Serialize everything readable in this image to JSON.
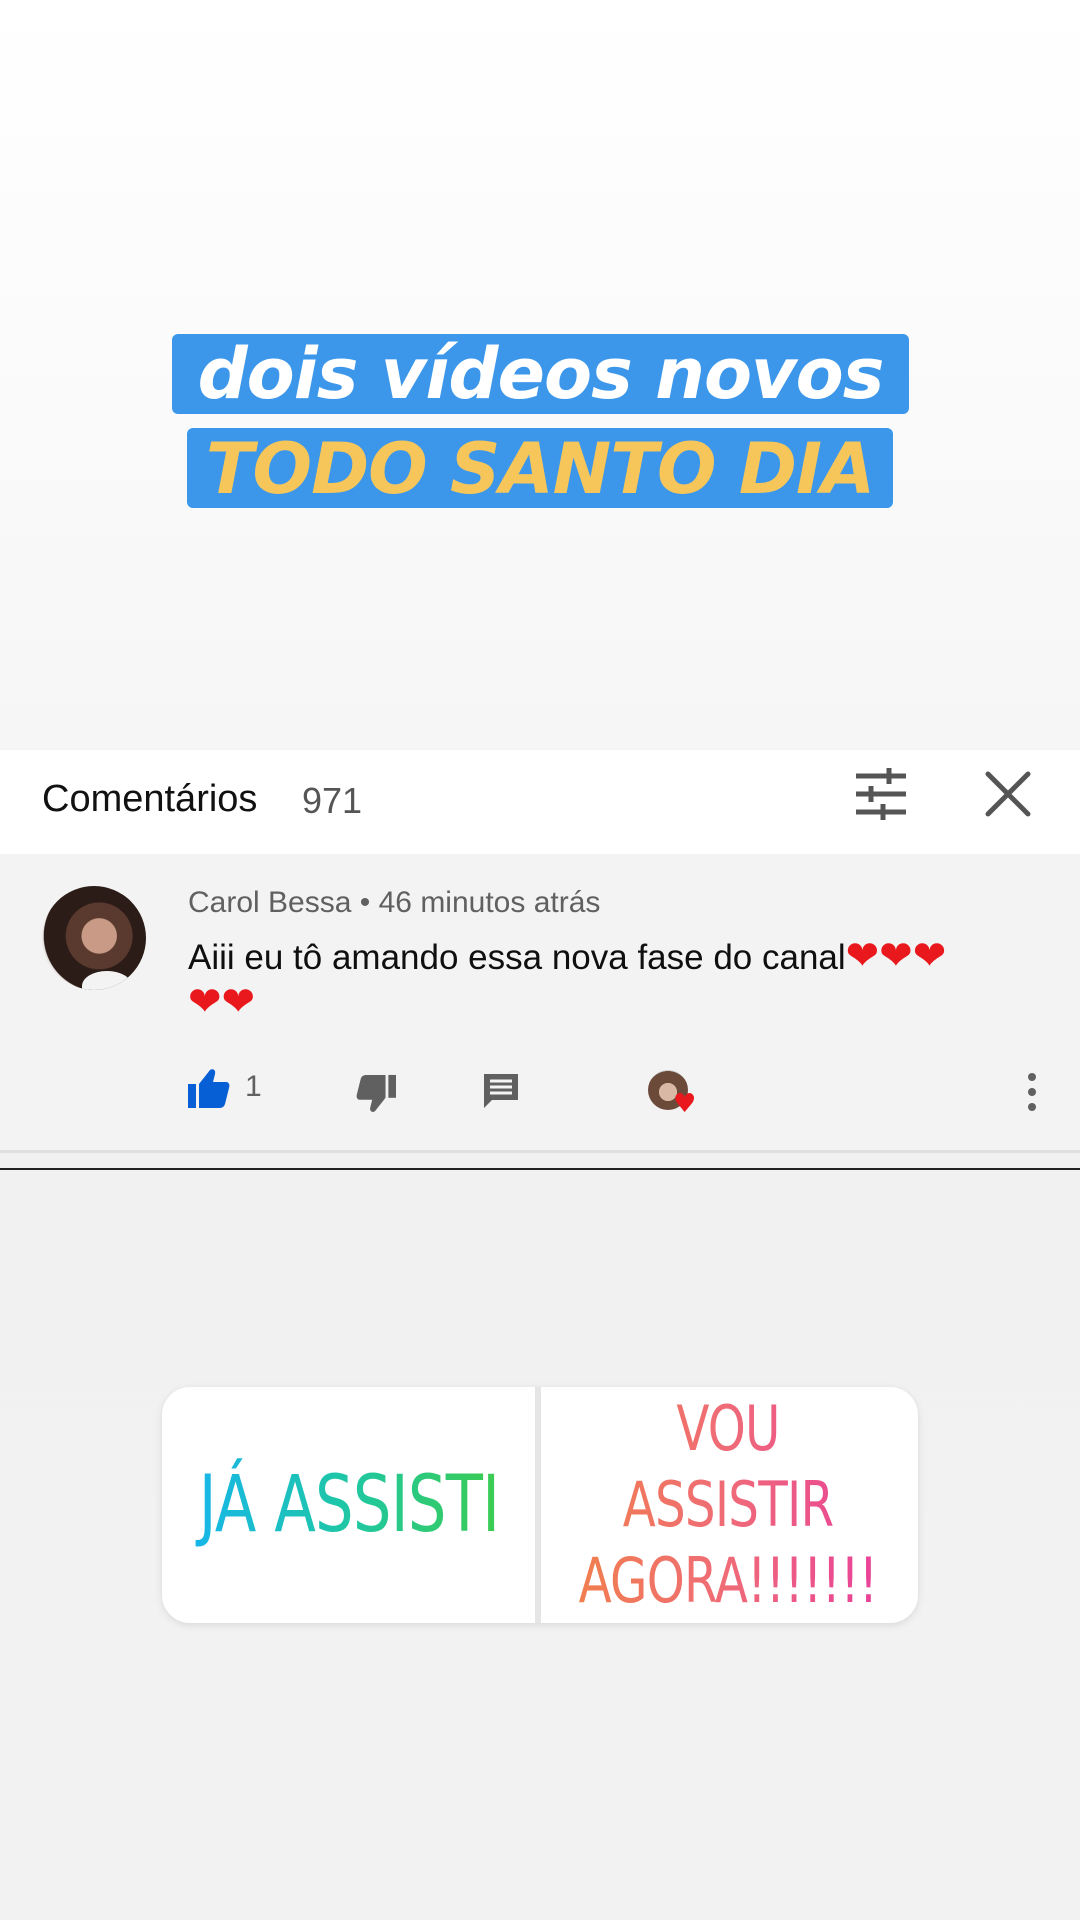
{
  "headline": {
    "line1": "dois vídeos novos",
    "line2": "TODO SANTO DIA"
  },
  "comments_header": {
    "title": "Comentários",
    "count": "971",
    "filter_icon": "sliders-icon",
    "close_icon": "close-icon"
  },
  "comment": {
    "author": "Carol Bessa",
    "separator": "•",
    "time": "46 minutos atrás",
    "text": "Aiii eu tô amando essa nova fase do canal",
    "hearts": "❤❤❤",
    "hearts_line2": "❤❤",
    "likes": "1",
    "icons": [
      "thumbs-up-icon",
      "thumbs-down-icon",
      "reply-icon",
      "creator-heart-icon",
      "more-vert-icon"
    ]
  },
  "poll": {
    "option1": "JÁ ASSISTI",
    "option2_line1": "VOU ASSISTIR",
    "option2_line2": "AGORA!!!!!!!"
  },
  "colors": {
    "headline_bg": "#3c97ea",
    "headline_line2": "#f6c65b",
    "like_blue": "#065fd4",
    "heart_red": "#e8181d"
  }
}
